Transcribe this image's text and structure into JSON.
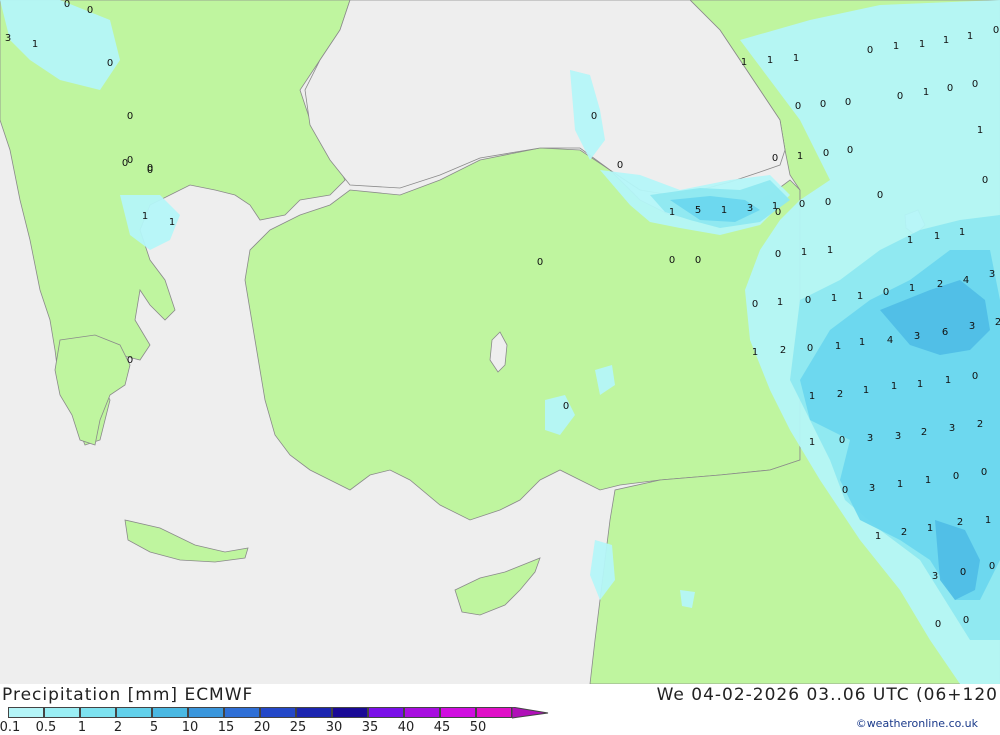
{
  "map": {
    "colors": {
      "sea": "#eeeeee",
      "land": "#bff59f",
      "precip_01": "#b4f5f8",
      "precip_05": "#8ee8f0",
      "precip_1": "#6cd7ee",
      "precip_2": "#4ebde6",
      "border": "#8a8a8a"
    },
    "values": [
      {
        "v": "3"
      },
      {
        "v": "1"
      },
      {
        "v": "0"
      },
      {
        "v": "0"
      },
      {
        "v": "0"
      },
      {
        "v": "0"
      },
      {
        "v": "0"
      },
      {
        "v": "0"
      },
      {
        "v": "1"
      },
      {
        "v": "1"
      },
      {
        "v": "0"
      },
      {
        "v": "0"
      },
      {
        "v": "0"
      },
      {
        "v": "0"
      },
      {
        "v": "1"
      },
      {
        "v": "0"
      },
      {
        "v": "5"
      },
      {
        "v": "1"
      },
      {
        "v": "3"
      },
      {
        "v": "1"
      },
      {
        "v": "0"
      },
      {
        "v": "0"
      },
      {
        "v": "1"
      },
      {
        "v": "0"
      },
      {
        "v": "0"
      },
      {
        "v": "0"
      },
      {
        "v": "0"
      },
      {
        "v": "0"
      },
      {
        "v": "1"
      },
      {
        "v": "1"
      },
      {
        "v": "1"
      },
      {
        "v": "1"
      },
      {
        "v": "0"
      },
      {
        "v": "1"
      },
      {
        "v": "1"
      },
      {
        "v": "1"
      },
      {
        "v": "0"
      },
      {
        "v": "0"
      },
      {
        "v": "0"
      },
      {
        "v": "0"
      },
      {
        "v": "1"
      },
      {
        "v": "0"
      },
      {
        "v": "0"
      },
      {
        "v": "1"
      },
      {
        "v": "0"
      },
      {
        "v": "1"
      },
      {
        "v": "1"
      },
      {
        "v": "1"
      },
      {
        "v": "0"
      },
      {
        "v": "1"
      },
      {
        "v": "1"
      },
      {
        "v": "0"
      },
      {
        "v": "0"
      },
      {
        "v": "0"
      },
      {
        "v": "1"
      },
      {
        "v": "0"
      },
      {
        "v": "2"
      },
      {
        "v": "4"
      },
      {
        "v": "3"
      },
      {
        "v": "1"
      },
      {
        "v": "1"
      },
      {
        "v": "0"
      },
      {
        "v": "1"
      },
      {
        "v": "1"
      },
      {
        "v": "4"
      },
      {
        "v": "3"
      },
      {
        "v": "6"
      },
      {
        "v": "3"
      },
      {
        "v": "2"
      },
      {
        "v": "1"
      },
      {
        "v": "2"
      },
      {
        "v": "0"
      },
      {
        "v": "1"
      },
      {
        "v": "1"
      },
      {
        "v": "2"
      },
      {
        "v": "1"
      },
      {
        "v": "1"
      },
      {
        "v": "1"
      },
      {
        "v": "1"
      },
      {
        "v": "0"
      },
      {
        "v": "1"
      },
      {
        "v": "0"
      },
      {
        "v": "3"
      },
      {
        "v": "3"
      },
      {
        "v": "2"
      },
      {
        "v": "3"
      },
      {
        "v": "2"
      },
      {
        "v": "0"
      },
      {
        "v": "3"
      },
      {
        "v": "1"
      },
      {
        "v": "1"
      },
      {
        "v": "0"
      },
      {
        "v": "0"
      },
      {
        "v": "1"
      },
      {
        "v": "2"
      },
      {
        "v": "1"
      },
      {
        "v": "0"
      },
      {
        "v": "1"
      },
      {
        "v": "2"
      },
      {
        "v": "3"
      },
      {
        "v": "0"
      },
      {
        "v": "0"
      },
      {
        "v": "0"
      },
      {
        "v": "0"
      },
      {
        "v": "0"
      },
      {
        "v": "0"
      }
    ]
  },
  "footer": {
    "title_left": "Precipitation [mm] ECMWF",
    "title_right": "We 04-02-2026 03..06 UTC (06+120",
    "credit": "©weatheronline.co.uk",
    "legend": {
      "ticks": [
        "0.1",
        "0.5",
        "1",
        "2",
        "5",
        "10",
        "15",
        "20",
        "25",
        "30",
        "35",
        "40",
        "45",
        "50"
      ],
      "colors": [
        "#b4f5f8",
        "#9aeef4",
        "#7de2f0",
        "#62d0ea",
        "#4ab8e2",
        "#3a96dc",
        "#2f6fd6",
        "#2448c8",
        "#1c25b0",
        "#1a0a96",
        "#7a10e8",
        "#a80ee0",
        "#d00ee0",
        "#e010c8"
      ]
    }
  }
}
